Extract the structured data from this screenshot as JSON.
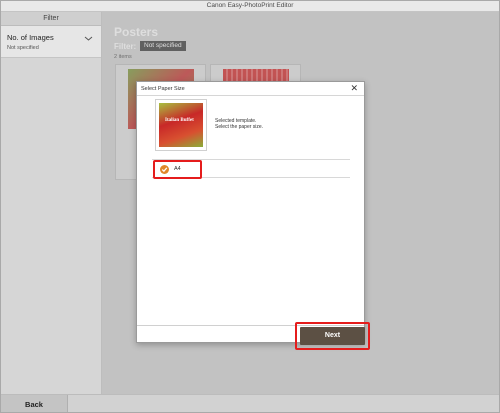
{
  "window": {
    "title": "Canon Easy-PhotoPrint Editor"
  },
  "sidebar": {
    "header": "Filter",
    "filter_item": {
      "name": "No. of Images",
      "value": "Not specified"
    }
  },
  "main": {
    "heading": "Posters",
    "filter_label": "Filter:",
    "filter_value": "Not specified",
    "item_count": "2 items"
  },
  "bottom": {
    "back_label": "Back"
  },
  "dialog": {
    "title": "Select Paper Size",
    "close_glyph": "✕",
    "template_thumb_text": "Italian Buffet",
    "description_line1": "Selected template.",
    "description_line2": "Select the paper size.",
    "options": [
      {
        "label": "A4",
        "selected": true
      }
    ],
    "next_label": "Next"
  },
  "colors": {
    "highlight": "#e51c1c",
    "check": "#e0862a",
    "next_button": "#5c5044"
  }
}
